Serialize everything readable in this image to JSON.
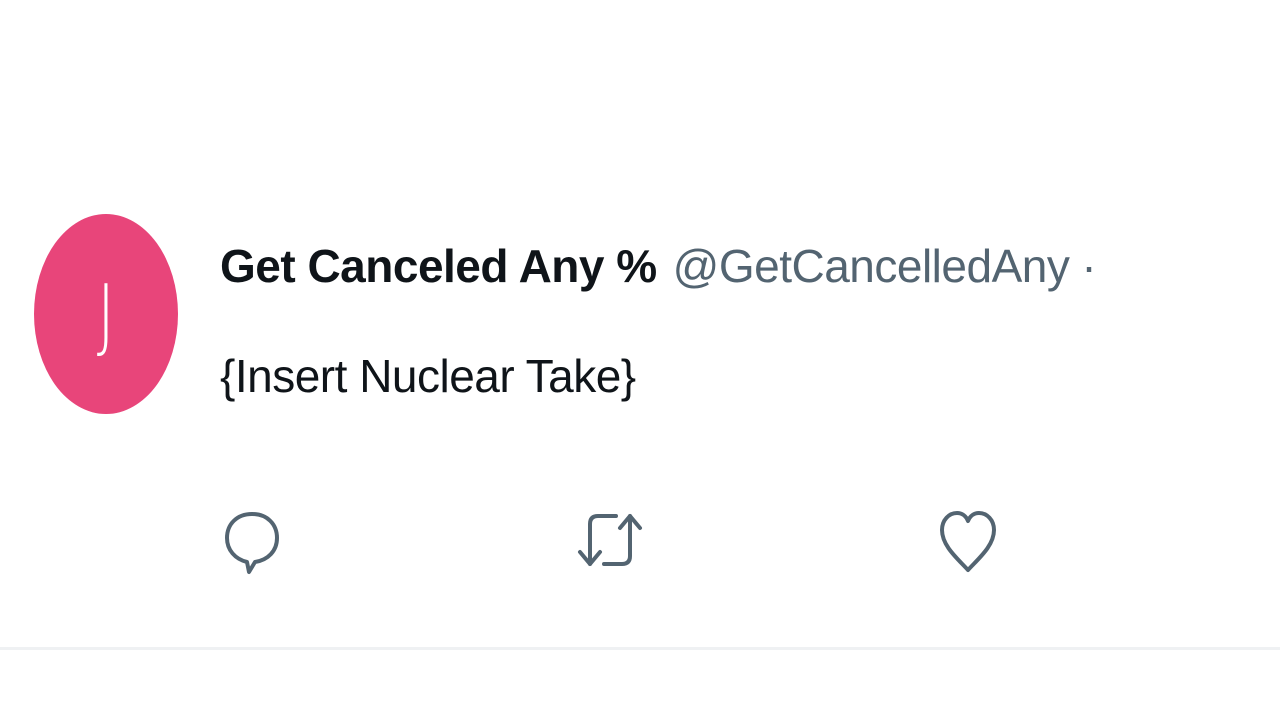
{
  "tweet": {
    "avatar_letter": "J",
    "avatar_color": "#e8457a",
    "display_name": "Get Canceled Any %",
    "handle": "@GetCancelledAny",
    "separator": "·",
    "text": "{Insert Nuclear Take}"
  },
  "actions": {
    "reply_icon": "reply-icon",
    "retweet_icon": "retweet-icon",
    "like_icon": "heart-icon",
    "icon_color": "#536471"
  }
}
